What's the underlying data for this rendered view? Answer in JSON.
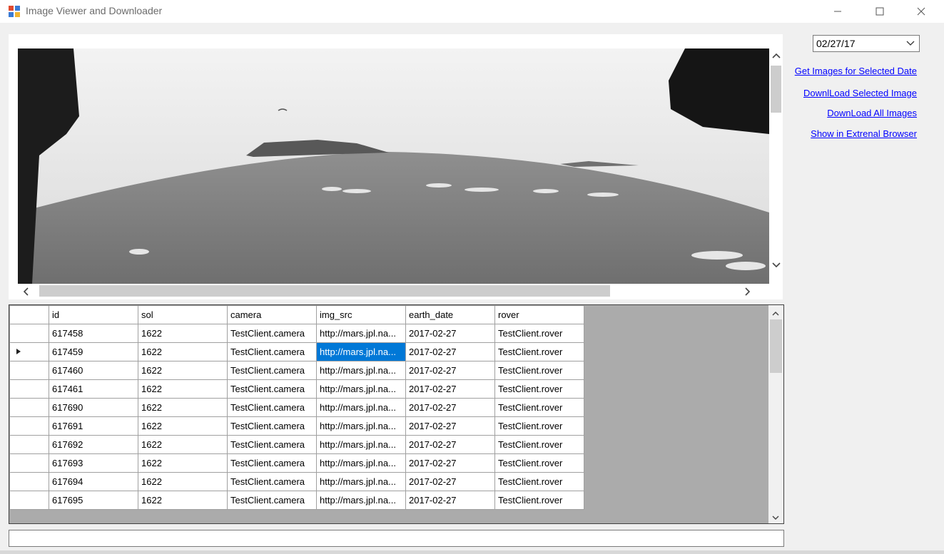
{
  "window": {
    "title": "Image Viewer and Downloader"
  },
  "controls": {
    "date_value": "02/27/17",
    "links": [
      "Get Images for Selected Date",
      "DownlLoad Selected Image",
      "DownLoad All Images",
      "Show in Extrenal Browser"
    ]
  },
  "grid": {
    "columns": [
      "id",
      "sol",
      "camera",
      "img_src",
      "earth_date",
      "rover"
    ],
    "selected_row": 1,
    "selected_col": 3,
    "rows": [
      [
        "617458",
        "1622",
        "TestClient.camera",
        "http://mars.jpl.na...",
        "2017-02-27",
        "TestClient.rover"
      ],
      [
        "617459",
        "1622",
        "TestClient.camera",
        "http://mars.jpl.na...",
        "2017-02-27",
        "TestClient.rover"
      ],
      [
        "617460",
        "1622",
        "TestClient.camera",
        "http://mars.jpl.na...",
        "2017-02-27",
        "TestClient.rover"
      ],
      [
        "617461",
        "1622",
        "TestClient.camera",
        "http://mars.jpl.na...",
        "2017-02-27",
        "TestClient.rover"
      ],
      [
        "617690",
        "1622",
        "TestClient.camera",
        "http://mars.jpl.na...",
        "2017-02-27",
        "TestClient.rover"
      ],
      [
        "617691",
        "1622",
        "TestClient.camera",
        "http://mars.jpl.na...",
        "2017-02-27",
        "TestClient.rover"
      ],
      [
        "617692",
        "1622",
        "TestClient.camera",
        "http://mars.jpl.na...",
        "2017-02-27",
        "TestClient.rover"
      ],
      [
        "617693",
        "1622",
        "TestClient.camera",
        "http://mars.jpl.na...",
        "2017-02-27",
        "TestClient.rover"
      ],
      [
        "617694",
        "1622",
        "TestClient.camera",
        "http://mars.jpl.na...",
        "2017-02-27",
        "TestClient.rover"
      ],
      [
        "617695",
        "1622",
        "TestClient.camera",
        "http://mars.jpl.na...",
        "2017-02-27",
        "TestClient.rover"
      ]
    ]
  },
  "colors": {
    "link": "#0000ff",
    "selection": "#0078d7",
    "grid_background": "#ababab"
  }
}
